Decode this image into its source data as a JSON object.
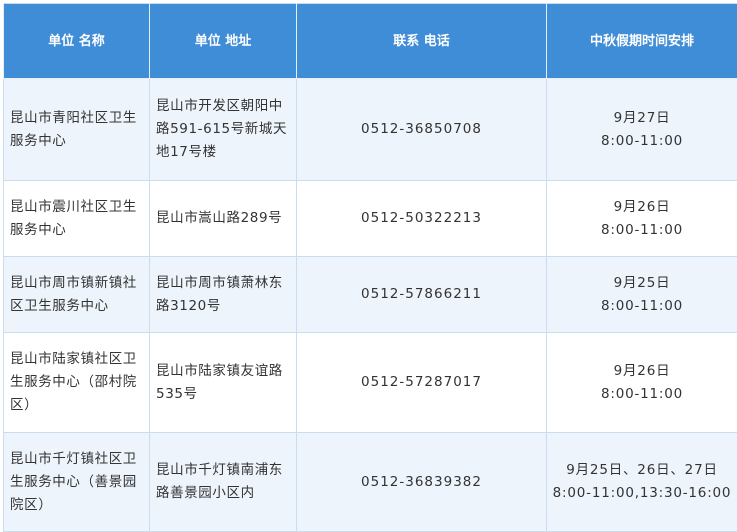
{
  "header": {
    "name_line1": "单位",
    "name_line2": "名称",
    "addr_line1": "单位",
    "addr_line2": "地址",
    "phone_line1": "联系",
    "phone_line2": "电话",
    "schedule": "中秋假期时间安排"
  },
  "rows": [
    {
      "name": "昆山市青阳社区卫生服务中心",
      "address": "昆山市开发区朝阳中路591-615号新城天地17号楼",
      "phone": "0512-36850708",
      "date": "9月27日",
      "time": "8:00-11:00"
    },
    {
      "name": "昆山市震川社区卫生服务中心",
      "address": "昆山市嵩山路289号",
      "phone": "0512-50322213",
      "date": "9月26日",
      "time": "8:00-11:00"
    },
    {
      "name": "昆山市周市镇新镇社区卫生服务中心",
      "address": "昆山市周市镇萧林东路3120号",
      "phone": "0512-57866211",
      "date": "9月25日",
      "time": "8:00-11:00"
    },
    {
      "name": "昆山市陆家镇社区卫生服务中心（邵村院区）",
      "address": "昆山市陆家镇友谊路535号",
      "phone": "0512-57287017",
      "date": "9月26日",
      "time": "8:00-11:00"
    },
    {
      "name": "昆山市千灯镇社区卫生服务中心（善景园院区）",
      "address": "昆山市千灯镇南浦东路善景园小区内",
      "phone": "0512-36839382",
      "date": "9月25日、26日、27日",
      "time": "8:00-11:00,13:30-16:00"
    }
  ]
}
